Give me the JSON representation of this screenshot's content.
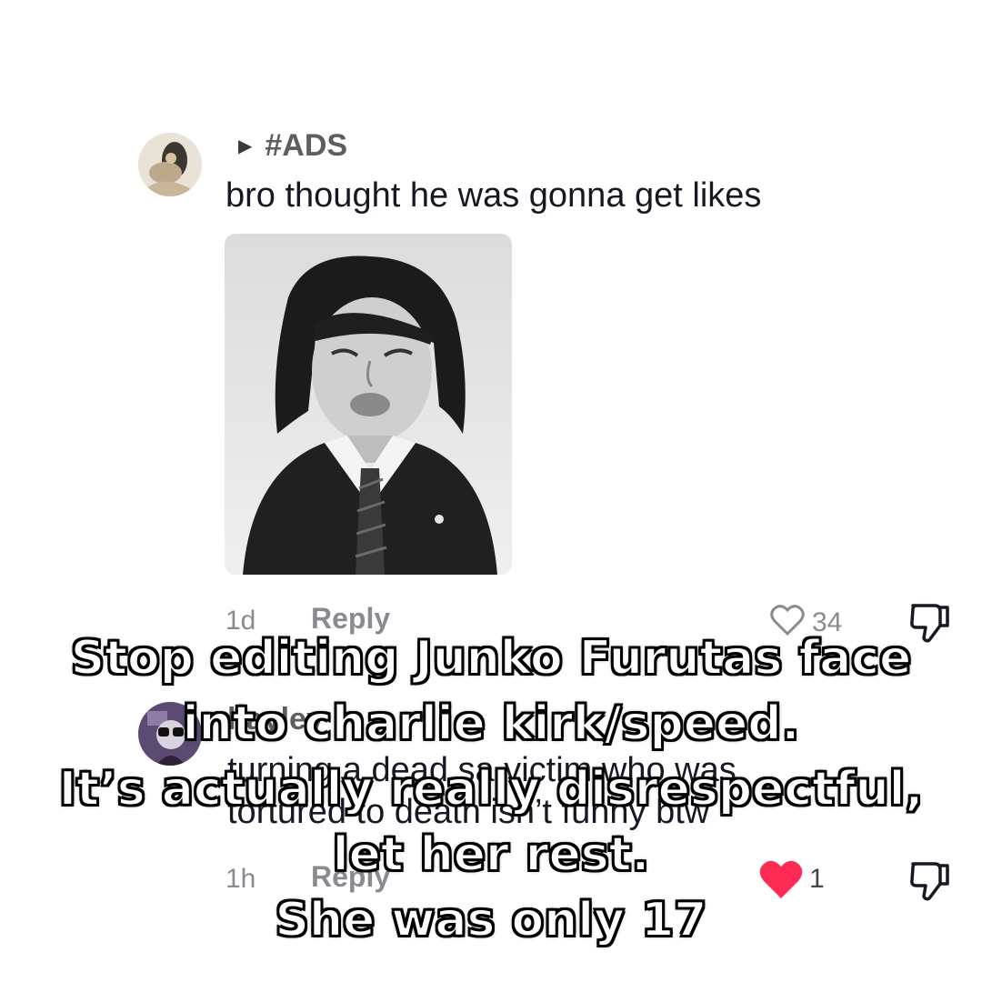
{
  "comments": [
    {
      "handle": "#ADS",
      "text": "bro thought he was gonna get likes",
      "time": "1d",
      "reply_label": "Reply",
      "like_count": "34",
      "liked": false
    },
    {
      "handle": "hayley",
      "text_line1": "turning a dead sa victim who was",
      "text_line2": "tortured to death isn’t funny btw",
      "time": "1h",
      "reply_label": "Reply",
      "like_count": "1",
      "liked": true
    }
  ],
  "caption": {
    "lines": [
      "Stop editing Junko Furutas face",
      "into charlie kirk/speed.",
      "It’s actually really disrespectful,",
      "let her rest.",
      "She was only 17"
    ]
  },
  "colors": {
    "liked_heart": "#fe2c55",
    "muted_text": "#8a8b91",
    "caption_fill": "#ffffff",
    "caption_stroke": "#000000"
  },
  "icons": {
    "like": "heart-icon",
    "dislike": "thumbs-down-icon",
    "expand": "triangle-right-icon"
  }
}
